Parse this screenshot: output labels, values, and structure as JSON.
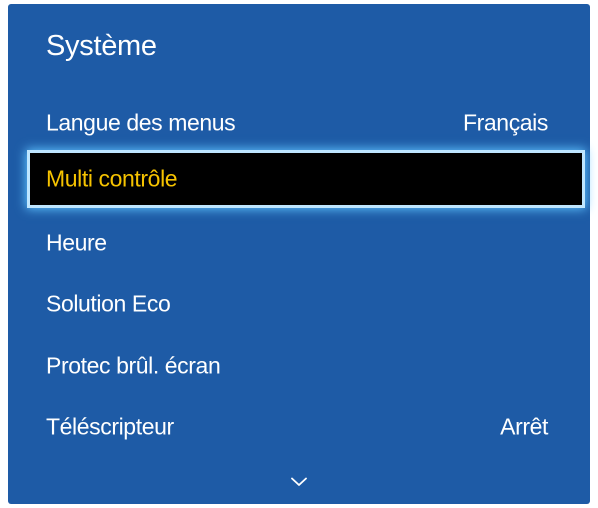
{
  "menu": {
    "title": "Système",
    "items": [
      {
        "label": "Langue des menus",
        "value": "Français"
      },
      {
        "label": "Multi contrôle",
        "value": ""
      },
      {
        "label": "Heure",
        "value": ""
      },
      {
        "label": "Solution Eco",
        "value": ""
      },
      {
        "label": "Protec brûl. écran",
        "value": ""
      },
      {
        "label": "Téléscripteur",
        "value": "Arrêt"
      }
    ],
    "selected_index": 1,
    "scroll_icon": "chevron-down-icon"
  },
  "colors": {
    "panel_background": "#1e5ba6",
    "selected_background": "#000000",
    "selected_text": "#f6c300",
    "selection_glow": "#5fc3ff",
    "text": "#ffffff"
  }
}
